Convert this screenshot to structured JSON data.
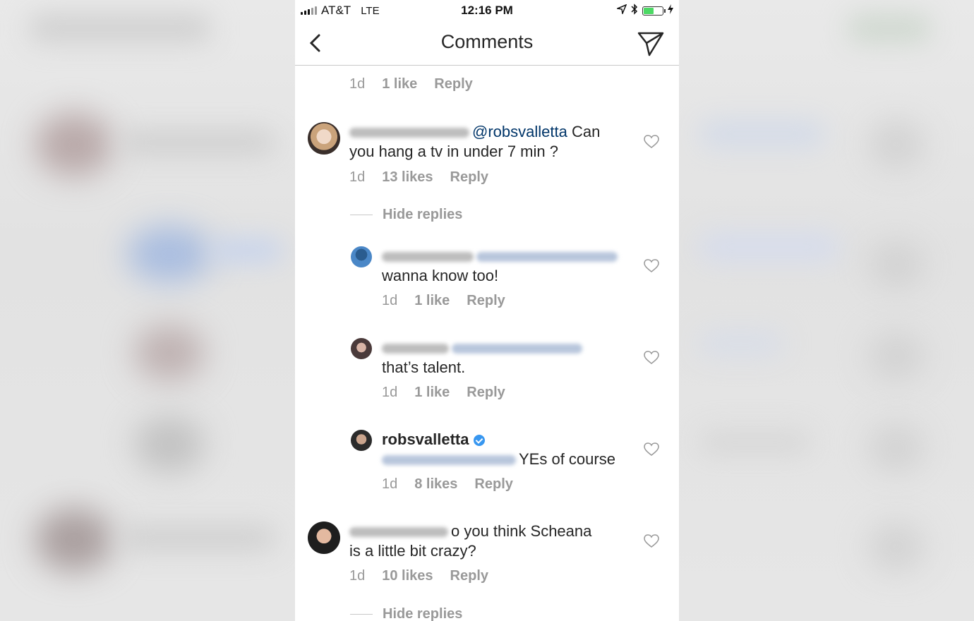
{
  "status_bar": {
    "carrier": "AT&T",
    "network": "LTE",
    "time": "12:16 PM",
    "battery_level": 0.55,
    "icons": [
      "location-icon",
      "bluetooth-icon",
      "battery-icon",
      "charging-icon"
    ]
  },
  "header": {
    "title": "Comments",
    "back_icon": "chevron-left-icon",
    "share_icon": "paper-plane-icon"
  },
  "top_meta": {
    "age": "1d",
    "likes": "1 like",
    "reply": "Reply"
  },
  "comments": [
    {
      "mention": "@robsvalletta",
      "text_line1": " Can",
      "text_line2": "you hang a tv in under 7 min ?",
      "age": "1d",
      "likes": "13 likes",
      "reply": "Reply",
      "hide_replies": "Hide replies"
    },
    {
      "text": "wanna know too!",
      "age": "1d",
      "likes": "1 like",
      "reply": "Reply"
    },
    {
      "text": "that’s talent.",
      "age": "1d",
      "likes": "1 like",
      "reply": "Reply"
    },
    {
      "username": "robsvalletta",
      "text": "YEs of course",
      "age": "1d",
      "likes": "8 likes",
      "reply": "Reply"
    },
    {
      "text_line1": "o you think Scheana",
      "text_line2": "is a little  bit crazy?",
      "age": "1d",
      "likes": "10 likes",
      "reply": "Reply",
      "hide_replies": "Hide replies"
    }
  ],
  "colors": {
    "mention": "#003569",
    "meta": "#999999",
    "verified": "#3897f0"
  }
}
